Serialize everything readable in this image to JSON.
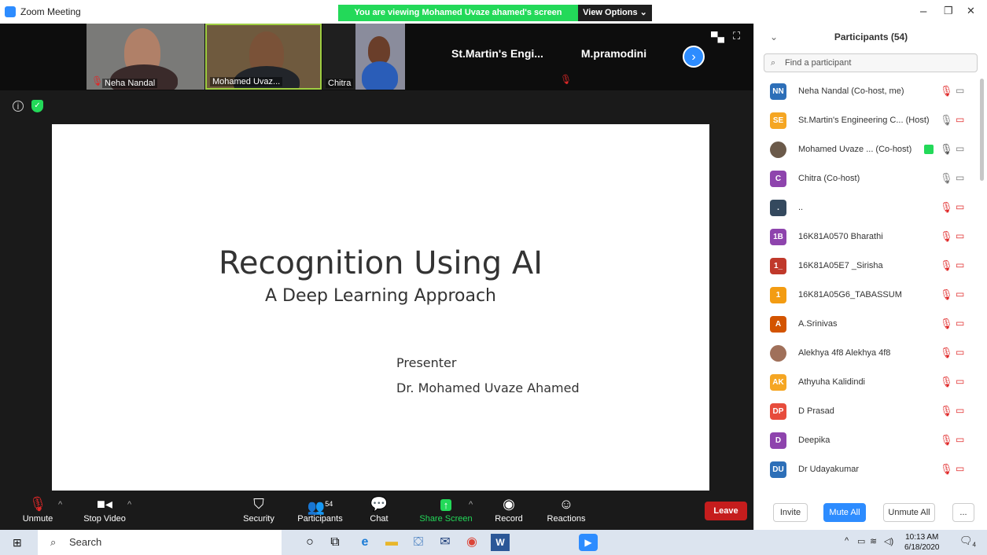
{
  "window": {
    "title": "Zoom Meeting",
    "banner": "You are viewing Mohamed Uvaze ahamed's screen",
    "view_options": "View Options ⌄",
    "min": "–",
    "max": "❐",
    "close": "✕"
  },
  "strip": {
    "tiles": [
      {
        "name": "Neha Nandal"
      },
      {
        "name": "Mohamed Uvaz..."
      },
      {
        "name": "Chitra"
      },
      {
        "name": "St.Martin's  Engi..."
      },
      {
        "name": "M.pramodini"
      }
    ],
    "next_icon": "chevron-right-icon"
  },
  "slide": {
    "title": "Recognition Using AI",
    "subtitle": "A Deep Learning Approach",
    "presenter_label": "Presenter",
    "presenter_name": "Dr. Mohamed Uvaze Ahamed"
  },
  "toolbar": {
    "unmute": "Unmute",
    "stop_video": "Stop Video",
    "security": "Security",
    "participants": "Participants",
    "participants_count": "54",
    "chat": "Chat",
    "share_screen": "Share Screen",
    "record": "Record",
    "reactions": "Reactions",
    "leave": "Leave"
  },
  "panel": {
    "title": "Participants (54)",
    "search_placeholder": "Find a participant",
    "participants": [
      {
        "initials": "NN",
        "name": "Neha Nandal (Co-host, me)",
        "color": "#2d6fb8"
      },
      {
        "initials": "SE",
        "name": "St.Martin's Engineering C... (Host)",
        "color": "#f5a623"
      },
      {
        "initials": "",
        "name": "Mohamed Uvaze ... (Co-host)",
        "color": "#6b5a4a"
      },
      {
        "initials": "C",
        "name": "Chitra (Co-host)",
        "color": "#8e44ad"
      },
      {
        "initials": ".",
        "name": "..",
        "color": "#34495e"
      },
      {
        "initials": "1B",
        "name": "16K81A0570 Bharathi",
        "color": "#8e44ad"
      },
      {
        "initials": "1_",
        "name": "16K81A05E7 _Sirisha",
        "color": "#c0392b"
      },
      {
        "initials": "1",
        "name": "16K81A05G6_TABASSUM",
        "color": "#f39c12"
      },
      {
        "initials": "A",
        "name": "A.Srinivas",
        "color": "#d35400"
      },
      {
        "initials": "",
        "name": "Alekhya 4f8 Alekhya  4f8",
        "color": "#a0705a"
      },
      {
        "initials": "AK",
        "name": "Athyuha Kalidindi",
        "color": "#f5a623"
      },
      {
        "initials": "DP",
        "name": "D Prasad",
        "color": "#e74c3c"
      },
      {
        "initials": "D",
        "name": "Deepika",
        "color": "#8e44ad"
      },
      {
        "initials": "DU",
        "name": "Dr Udayakumar",
        "color": "#2d6fb8"
      }
    ],
    "invite": "Invite",
    "mute_all": "Mute All",
    "unmute_all": "Unmute All",
    "more": "..."
  },
  "taskbar": {
    "search": "Search",
    "time": "10:13 AM",
    "date": "6/18/2020",
    "notif_count": "4"
  }
}
